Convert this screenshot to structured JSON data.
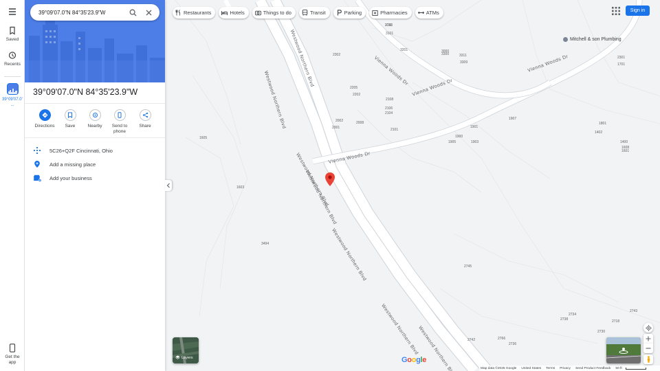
{
  "search": {
    "value": "39°09'07.0\"N 84°35'23.9\"W"
  },
  "rail": {
    "saved": "Saved",
    "recents": "Recents",
    "recent_place": "39°09'07.0\"N ...",
    "get_app": "Get the app"
  },
  "place": {
    "title": "39°09'07.0\"N 84°35'23.9\"W",
    "actions": [
      {
        "label": "Directions",
        "icon": "directions-icon"
      },
      {
        "label": "Save",
        "icon": "bookmark-icon"
      },
      {
        "label": "Nearby",
        "icon": "nearby-icon"
      },
      {
        "label": "Send to phone",
        "icon": "phone-icon"
      },
      {
        "label": "Share",
        "icon": "share-icon"
      }
    ],
    "plus_code": "5C26+Q2F Cincinnati, Ohio",
    "add_missing_place": "Add a missing place",
    "add_business": "Add your business"
  },
  "chips": [
    {
      "label": "Restaurants",
      "icon": "restaurant-icon"
    },
    {
      "label": "Hotels",
      "icon": "hotel-icon"
    },
    {
      "label": "Things to do",
      "icon": "camera-icon"
    },
    {
      "label": "Transit",
      "icon": "transit-icon"
    },
    {
      "label": "Parking",
      "icon": "parking-icon"
    },
    {
      "label": "Pharmacies",
      "icon": "pharmacy-icon"
    },
    {
      "label": "ATMs",
      "icon": "atm-icon"
    }
  ],
  "signin": "Sign in",
  "layers_label": "Layers",
  "map_labels": {
    "roads": {
      "westwood_northern_blvd": "Westwood Northern Blvd",
      "vienna_woods_dr": "Vienna Woods Dr"
    },
    "business": "Mitchell & son Plumbing",
    "addresses": [
      "3111",
      "3101",
      "3000",
      "2302",
      "3201",
      "3300",
      "3311",
      "3309",
      "2205",
      "2202",
      "2108",
      "2106",
      "2104",
      "2002",
      "2008",
      "2001",
      "2101",
      "1900",
      "1901",
      "1905",
      "1903",
      "1907",
      "1801",
      "2301",
      "1701",
      "1402",
      "1400",
      "1608",
      "1601",
      "1605",
      "1603",
      "3494",
      "2745",
      "2743",
      "2718",
      "2730",
      "2734",
      "2738",
      "2742",
      "2766",
      "2736",
      "2740"
    ]
  },
  "footer": {
    "map_data": "Map data ©2025 Google",
    "country": "United States",
    "terms": "Terms",
    "privacy": "Privacy",
    "feedback": "Send Product Feedback",
    "scale": "50 ft"
  },
  "google_logo": "Google",
  "colors": {
    "accent": "#1a73e8",
    "pin": "#ea4335",
    "road": "#ffffff",
    "map_bg": "#f1f3f4"
  }
}
